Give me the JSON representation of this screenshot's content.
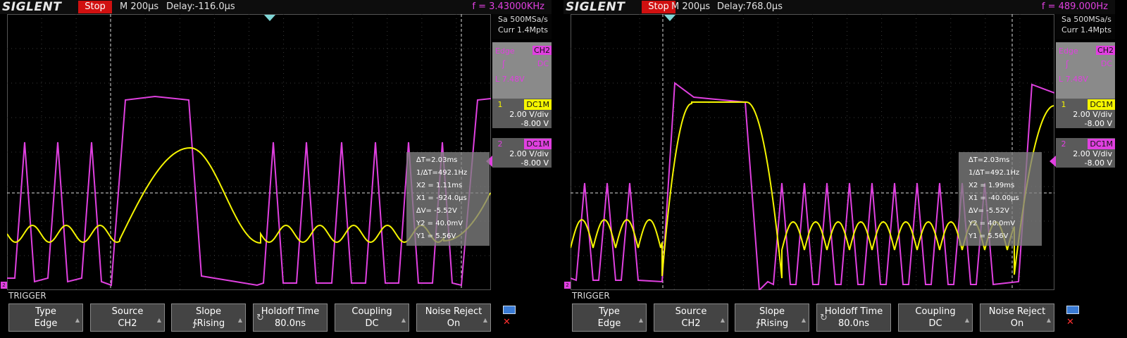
{
  "screens": [
    {
      "brand": "SIGLENT",
      "status": "Stop",
      "timebase": "M 200μs",
      "delay": "Delay:-116.0μs",
      "frequency": "f = 3.43000KHz",
      "sample_rate": "Sa 500MSa/s",
      "memory_depth": "Curr 1.4Mpts",
      "trigger": {
        "type": "Edge",
        "source": "CH2",
        "coupling": "DC",
        "level": "L  7.48V"
      },
      "channels": [
        {
          "num": "1",
          "coupling": "DC1M",
          "vdiv": "2.00 V/div",
          "offset": "-8.00 V",
          "color": "#f5f500"
        },
        {
          "num": "2",
          "coupling": "DC1M",
          "vdiv": "2.00 V/div",
          "offset": "-8.00 V",
          "color": "#e040e0"
        }
      ],
      "measurements": [
        "∆T=2.03ms",
        "1/∆T=492.1Hz",
        "X2 = 1.11ms",
        "X1 = -924.0μs",
        "∆V= -5.52V",
        "Y2 = 40.0mV",
        "Y1 = 5.56V"
      ],
      "menu_title": "TRIGGER",
      "softkeys": [
        {
          "l1": "Type",
          "l2": "Edge"
        },
        {
          "l1": "Source",
          "l2": "CH2"
        },
        {
          "l1": "Slope",
          "l2": "∱Rising"
        },
        {
          "l1": "Holdoff Time",
          "l2": "80.0ns"
        },
        {
          "l1": "Coupling",
          "l2": "DC"
        },
        {
          "l1": "Noise Reject",
          "l2": "On"
        }
      ]
    },
    {
      "brand": "SIGLENT",
      "status": "Stop",
      "timebase": "M 200μs",
      "delay": "Delay:768.0μs",
      "frequency": "f = 489.000Hz",
      "sample_rate": "Sa 500MSa/s",
      "memory_depth": "Curr 1.4Mpts",
      "trigger": {
        "type": "Edge",
        "source": "CH2",
        "coupling": "DC",
        "level": "L  7.48V"
      },
      "channels": [
        {
          "num": "1",
          "coupling": "DC1M",
          "vdiv": "2.00 V/div",
          "offset": "-8.00 V",
          "color": "#f5f500"
        },
        {
          "num": "2",
          "coupling": "DC1M",
          "vdiv": "2.00 V/div",
          "offset": "-8.00 V",
          "color": "#e040e0"
        }
      ],
      "measurements": [
        "∆T=2.03ms",
        "1/∆T=492.1Hz",
        "X2 = 1.99ms",
        "X1 = -40.00μs",
        "∆V= -5.52V",
        "Y2 = 40.0mV",
        "Y1 = 5.56V"
      ],
      "menu_title": "TRIGGER",
      "softkeys": [
        {
          "l1": "Type",
          "l2": "Edge"
        },
        {
          "l1": "Source",
          "l2": "CH2"
        },
        {
          "l1": "Slope",
          "l2": "∱Rising"
        },
        {
          "l1": "Holdoff Time",
          "l2": "80.0ns"
        },
        {
          "l1": "Coupling",
          "l2": "DC"
        },
        {
          "l1": "Noise Reject",
          "l2": "On"
        }
      ]
    }
  ],
  "colors": {
    "ch1": "#f5f500",
    "ch2": "#e040e0",
    "stop": "#d01010",
    "trigger_marker": "#7fd6d6"
  },
  "icons": [
    "trigger-position-icon",
    "slope-rising-icon",
    "holdoff-knob-icon",
    "lan-icon",
    "usb-icon",
    "ground-marker-icon"
  ]
}
